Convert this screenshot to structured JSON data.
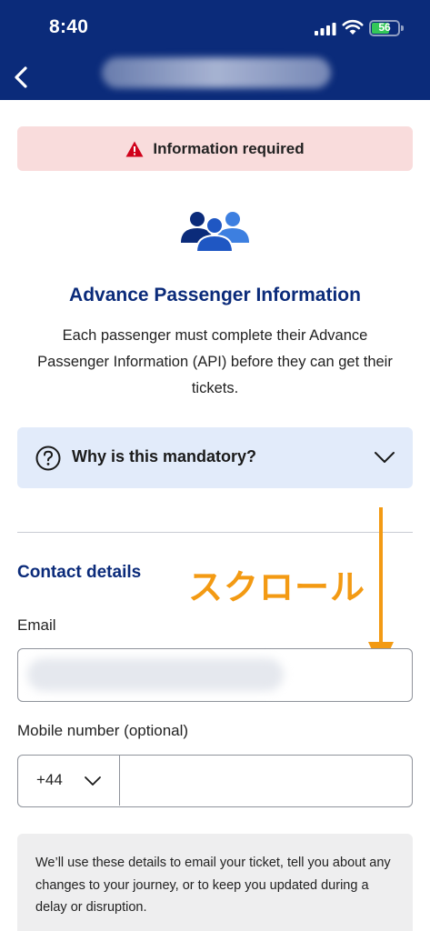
{
  "status_bar": {
    "time": "8:40",
    "battery_level": "56",
    "battery_color": "#34c759"
  },
  "nav": {
    "back_icon": "chevron-left-icon",
    "title_redacted": true,
    "background_color": "#0b2b7a"
  },
  "alert": {
    "icon": "warning-triangle-icon",
    "text": "Information required",
    "background_color": "#f9dcdc",
    "icon_color": "#d0021b"
  },
  "hero": {
    "icon": "passengers-group-icon",
    "title": "Advance Passenger Information",
    "description": "Each passenger must complete their Advance Passenger Information (API) before they can get their tickets.",
    "title_color": "#0b2b7a"
  },
  "accordion": {
    "icon": "question-circle-icon",
    "label": "Why is this mandatory?",
    "chevron": "chevron-down-icon",
    "expanded": false,
    "background_color": "#e2ebfa"
  },
  "contact": {
    "heading": "Contact details",
    "email_label": "Email",
    "email_value_redacted": true,
    "mobile_label": "Mobile number (optional)",
    "country_code": "+44",
    "mobile_value": ""
  },
  "annotation": {
    "text": "スクロール",
    "color": "#f39a13",
    "arrow_icon": "arrow-down-icon"
  },
  "info": {
    "text": "We’ll use these details to email your ticket, tell you about any changes to your journey, or to keep you updated during a delay or disruption."
  }
}
